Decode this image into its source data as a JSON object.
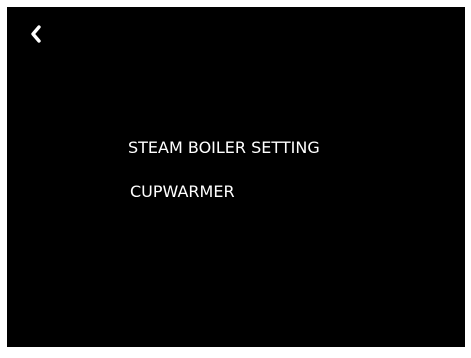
{
  "screen": {
    "background": "#000000",
    "back_icon": "chevron-left-icon",
    "menu_items": [
      {
        "label": "STEAM BOILER SETTING"
      },
      {
        "label": "CUPWARMER"
      }
    ]
  }
}
